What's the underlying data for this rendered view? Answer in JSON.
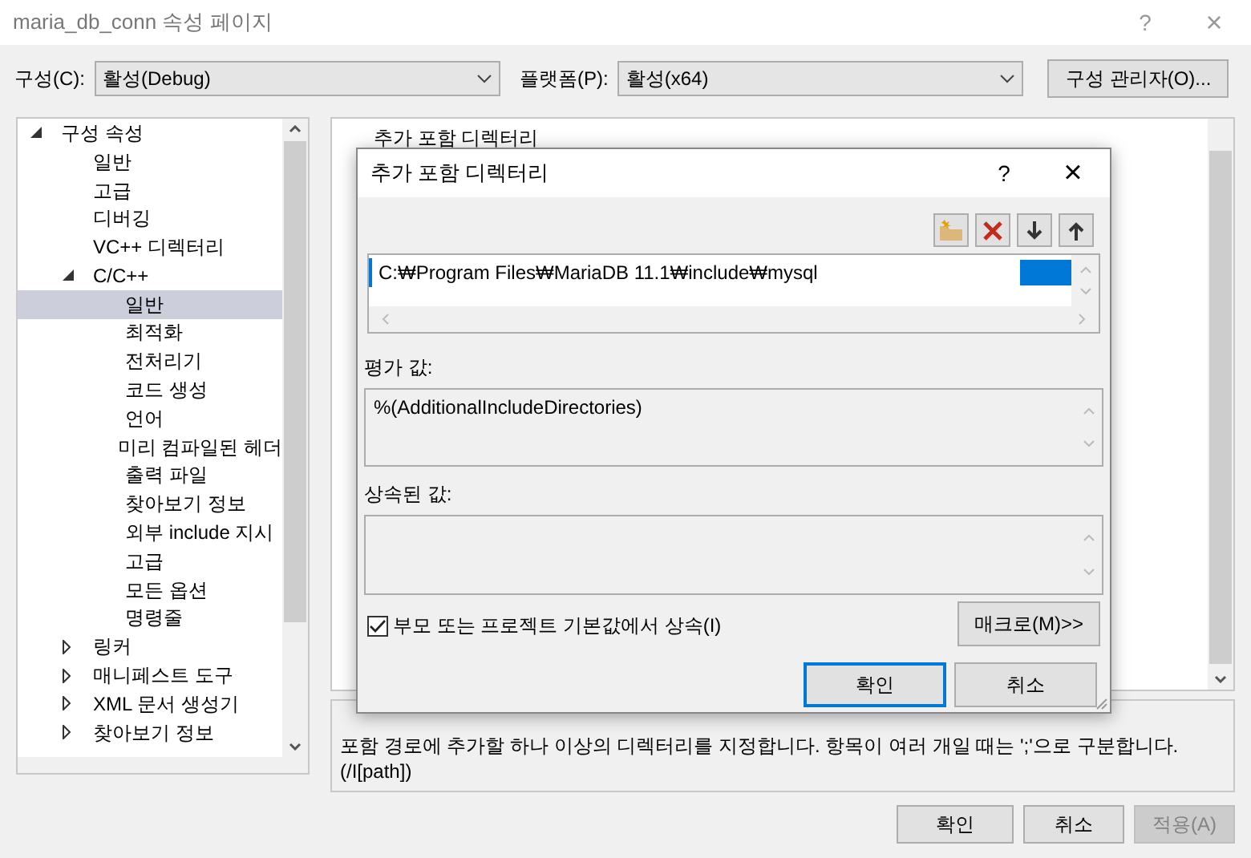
{
  "window": {
    "title": "maria_db_conn 속성 페이지",
    "help": "?",
    "close": "×"
  },
  "config": {
    "label": "구성(C):",
    "value": "활성(Debug)"
  },
  "platform": {
    "label": "플랫폼(P):",
    "value": "활성(x64)"
  },
  "config_manager": "구성 관리자(O)...",
  "tree": [
    {
      "label": "구성 속성",
      "expanded": true,
      "selected": false,
      "children": [
        {
          "label": "일반",
          "selected": false
        },
        {
          "label": "고급",
          "selected": false
        },
        {
          "label": "디버깅",
          "selected": false
        },
        {
          "label": "VC++ 디렉터리",
          "selected": false
        },
        {
          "label": "C/C++",
          "expanded": true,
          "selected": false,
          "children": [
            {
              "label": "일반",
              "selected": true
            },
            {
              "label": "최적화",
              "selected": false
            },
            {
              "label": "전처리기",
              "selected": false
            },
            {
              "label": "코드 생성",
              "selected": false
            },
            {
              "label": "언어",
              "selected": false
            },
            {
              "label": "미리 컴파일된 헤더",
              "selected": false
            },
            {
              "label": "출력 파일",
              "selected": false
            },
            {
              "label": "찾아보기 정보",
              "selected": false
            },
            {
              "label": "외부 include 지시",
              "selected": false
            },
            {
              "label": "고급",
              "selected": false
            },
            {
              "label": "모든 옵션",
              "selected": false
            },
            {
              "label": "명령줄",
              "selected": false
            }
          ]
        },
        {
          "label": "링커",
          "expanded": false,
          "selected": false
        },
        {
          "label": "매니페스트 도구",
          "expanded": false,
          "selected": false
        },
        {
          "label": "XML 문서 생성기",
          "expanded": false,
          "selected": false
        },
        {
          "label": "찾아보기 정보",
          "expanded": false,
          "selected": false
        }
      ]
    }
  ],
  "property_grid": {
    "rows": [
      "추가 포함 디렉터리"
    ]
  },
  "description": {
    "text": "포함 경로에 추가할 하나 이상의 디렉터리를 지정합니다. 항목이 여러 개일 때는 ';'으로 구분합니다.",
    "switch": "(/I[path])"
  },
  "buttons": [
    {
      "label": "확인",
      "disabled": false
    },
    {
      "label": "취소",
      "disabled": false
    },
    {
      "label": "적용(A)",
      "disabled": true
    }
  ],
  "dialog": {
    "title": "추가 포함 디렉터리",
    "help": "?",
    "close": "×",
    "directories": [
      {
        "path": "C:₩Program Files₩MariaDB 11.1₩include₩mysql",
        "selected": true
      }
    ],
    "evaluated_label": "평가 값:",
    "evaluated_value": "%(AdditionalIncludeDirectories)",
    "inherited_label": "상속된 값:",
    "inherit": {
      "label": "부모 또는 프로젝트 기본값에서 상속(I)",
      "checked": true
    },
    "macros": "매크로(M)>>",
    "buttons": [
      {
        "label": "확인",
        "default": true
      },
      {
        "label": "취소",
        "default": false
      }
    ]
  }
}
